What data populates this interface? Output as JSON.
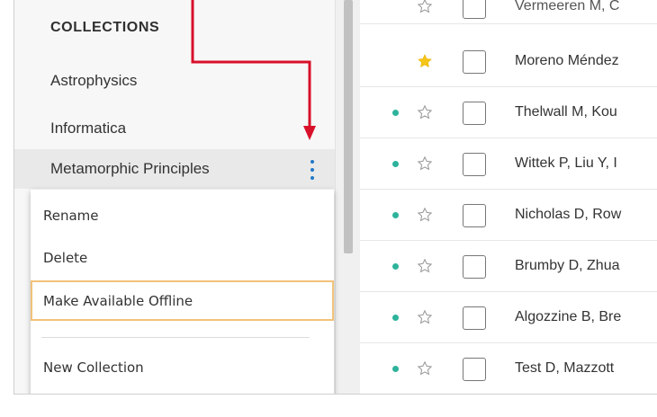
{
  "sidebar": {
    "title": "COLLECTIONS",
    "items": [
      {
        "label": "Astrophysics"
      },
      {
        "label": "Informatica"
      },
      {
        "label": "Metamorphic Principles"
      }
    ]
  },
  "context_menu": {
    "rename": "Rename",
    "delete": "Delete",
    "offline": "Make Available Offline",
    "new_collection": "New Collection"
  },
  "list": {
    "rows": [
      {
        "author": "Vermeeren M, C",
        "unread": false,
        "starred": false
      },
      {
        "author": "Moreno Méndez",
        "unread": false,
        "starred": true
      },
      {
        "author": "Thelwall M, Kou",
        "unread": true,
        "starred": false
      },
      {
        "author": "Wittek P, Liu Y, I",
        "unread": true,
        "starred": false
      },
      {
        "author": "Nicholas D, Row",
        "unread": true,
        "starred": false
      },
      {
        "author": "Brumby D, Zhua",
        "unread": true,
        "starred": false
      },
      {
        "author": "Algozzine B, Bre",
        "unread": true,
        "starred": false
      },
      {
        "author": "Test D, Mazzott",
        "unread": true,
        "starred": false
      }
    ]
  },
  "colors": {
    "accent": "#1f78c7",
    "unread_dot": "#2db39b",
    "star_filled": "#f5c518",
    "annotation_arrow": "#d8102a",
    "offline_highlight": "#f2c27a"
  }
}
